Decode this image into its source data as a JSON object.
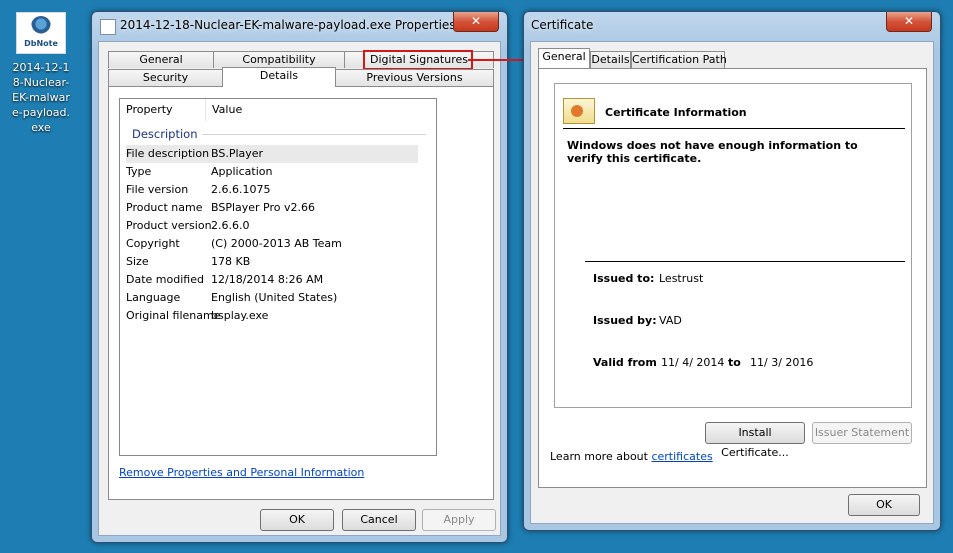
{
  "desktop_icon": {
    "logo_text": "DbNote",
    "caption": "2014-12-18-Nuclear-EK-malware-payload.exe"
  },
  "properties_window": {
    "title": "2014-12-18-Nuclear-EK-malware-payload.exe Properties",
    "close_glyph": "✕",
    "tabs_row1": [
      "General",
      "Compatibility",
      "Digital Signatures"
    ],
    "tabs_row2": [
      "Security",
      "Details",
      "Previous Versions"
    ],
    "list_headers": [
      "Property",
      "Value"
    ],
    "group_label": "Description",
    "rows": [
      {
        "k": "File description",
        "v": "BS.Player"
      },
      {
        "k": "Type",
        "v": "Application"
      },
      {
        "k": "File version",
        "v": "2.6.6.1075"
      },
      {
        "k": "Product name",
        "v": "BSPlayer Pro v2.66"
      },
      {
        "k": "Product version",
        "v": "2.6.6.0"
      },
      {
        "k": "Copyright",
        "v": "(C) 2000-2013 AB Team"
      },
      {
        "k": "Size",
        "v": "178 KB"
      },
      {
        "k": "Date modified",
        "v": "12/18/2014 8:26 AM"
      },
      {
        "k": "Language",
        "v": "English (United States)"
      },
      {
        "k": "Original filename",
        "v": "bsplay.exe"
      }
    ],
    "remove_link": "Remove Properties and Personal Information",
    "ok": "OK",
    "cancel": "Cancel",
    "apply": "Apply"
  },
  "certificate_window": {
    "title": "Certificate",
    "close_glyph": "✕",
    "tabs": [
      "General",
      "Details",
      "Certification Path"
    ],
    "info_heading": "Certificate Information",
    "warning": "Windows does not have enough information to verify this certificate.",
    "issued_to_label": "Issued to:",
    "issued_to": "Lestrust",
    "issued_by_label": "Issued by:",
    "issued_by": "VAD",
    "valid_from_label": "Valid from",
    "valid_from": "11/ 4/ 2014",
    "valid_to_label": "to",
    "valid_to": "11/ 3/ 2016",
    "install_button": "Install Certificate...",
    "issuer_button": "Issuer Statement",
    "learn_prefix": "Learn more about ",
    "learn_link": "certificates",
    "ok": "OK"
  },
  "colors": {
    "desktop": "#1e7eb3",
    "highlight": "#d0191a",
    "link": "#0044cc"
  }
}
